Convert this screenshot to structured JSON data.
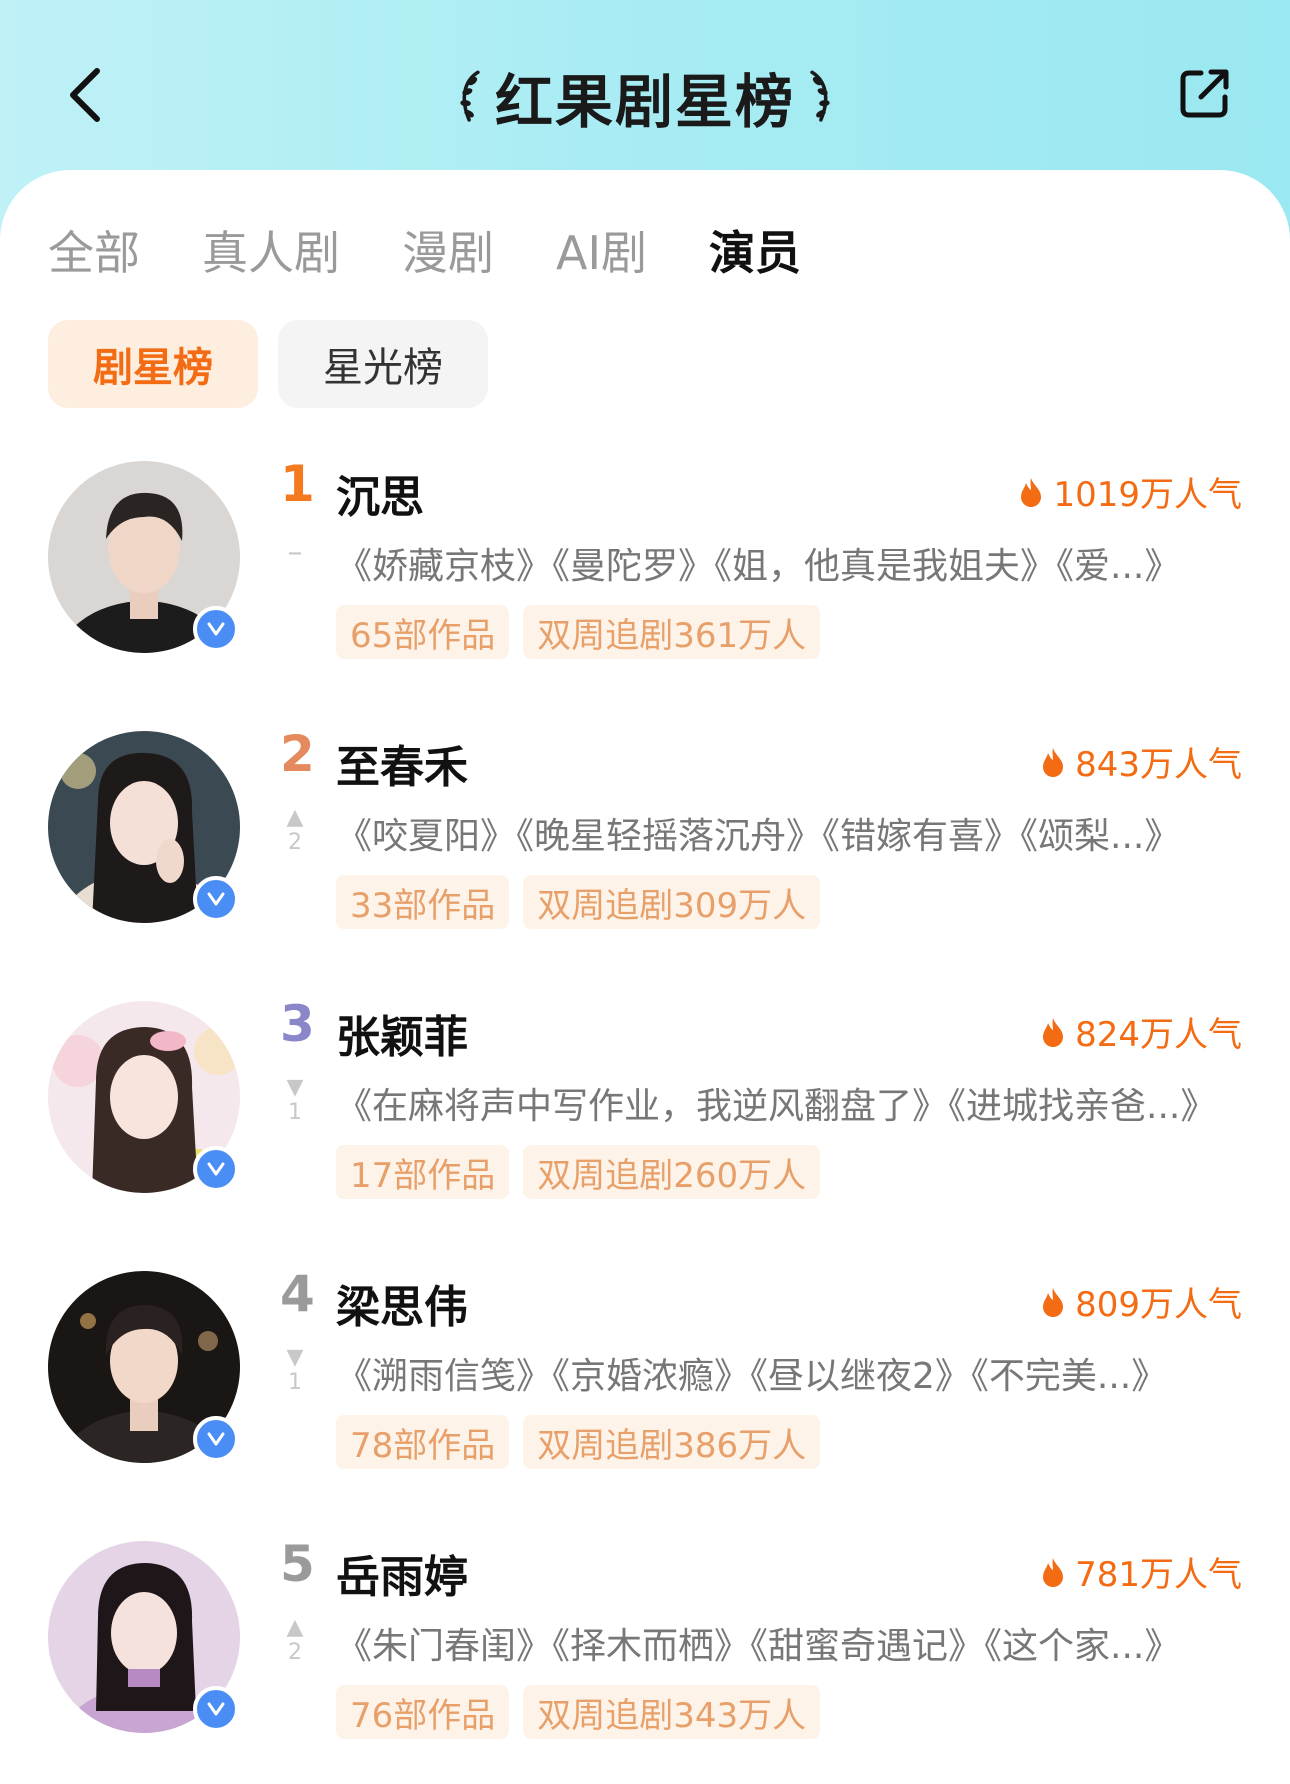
{
  "header": {
    "title": "红果剧星榜",
    "back_icon": "back-arrow-icon",
    "share_icon": "share-icon",
    "bg_color": "#a8ecf3"
  },
  "tabs": [
    {
      "label": "全部",
      "active": false
    },
    {
      "label": "真人剧",
      "active": false
    },
    {
      "label": "漫剧",
      "active": false
    },
    {
      "label": "AI剧",
      "active": false
    },
    {
      "label": "演员",
      "active": true
    }
  ],
  "subtabs": [
    {
      "label": "剧星榜",
      "active": true
    },
    {
      "label": "星光榜",
      "active": false
    }
  ],
  "accent_color": "#f36b12",
  "rankings": [
    {
      "rank": "1",
      "rank_color": "#f47a1f",
      "name": "沉思",
      "trend": "none",
      "trend_symbol": "–",
      "trend_value": "",
      "popularity": "1019万人气",
      "works": "《娇藏京枝》《曼陀罗》《姐，他真是我姐夫》《爱...》",
      "works_count": "65部作品",
      "followers": "双周追剧361万人"
    },
    {
      "rank": "2",
      "rank_color": "#e58a5e",
      "name": "至春禾",
      "trend": "up",
      "trend_symbol": "▲",
      "trend_value": "2",
      "popularity": "843万人气",
      "works": "《咬夏阳》《晚星轻摇落沉舟》《错嫁有喜》《颂梨...》",
      "works_count": "33部作品",
      "followers": "双周追剧309万人"
    },
    {
      "rank": "3",
      "rank_color": "#8a86c9",
      "name": "张颖菲",
      "trend": "down",
      "trend_symbol": "▼",
      "trend_value": "1",
      "popularity": "824万人气",
      "works": "《在麻将声中写作业，我逆风翻盘了》《进城找亲爸...》",
      "works_count": "17部作品",
      "followers": "双周追剧260万人"
    },
    {
      "rank": "4",
      "rank_color": "#9a9a9a",
      "name": "梁思伟",
      "trend": "down",
      "trend_symbol": "▼",
      "trend_value": "1",
      "popularity": "809万人气",
      "works": "《溯雨信笺》《京婚浓瘾》《昼以继夜2》《不完美...》",
      "works_count": "78部作品",
      "followers": "双周追剧386万人"
    },
    {
      "rank": "5",
      "rank_color": "#9a9a9a",
      "name": "岳雨婷",
      "trend": "up",
      "trend_symbol": "▲",
      "trend_value": "2",
      "popularity": "781万人气",
      "works": "《朱门春闺》《择木而栖》《甜蜜奇遇记》《这个家...》",
      "works_count": "76部作品",
      "followers": "双周追剧343万人"
    }
  ]
}
